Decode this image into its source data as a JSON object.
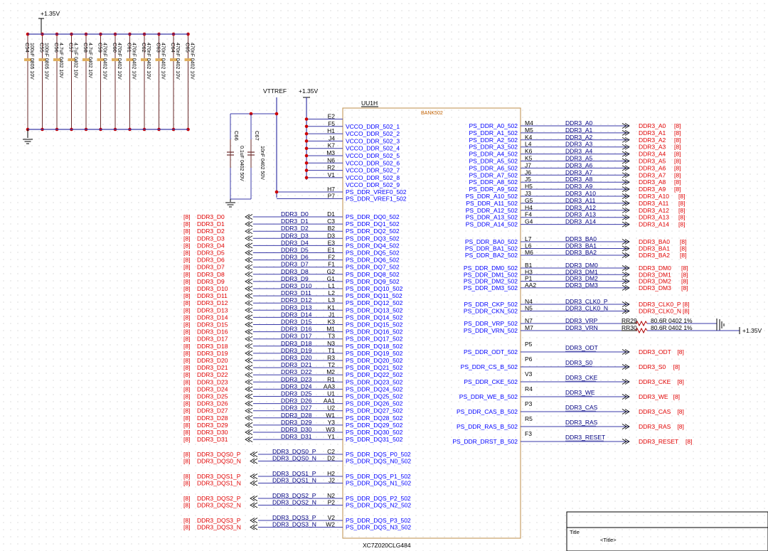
{
  "power": {
    "vcc": "+1.35V",
    "vttref": "VTTREF"
  },
  "decoupling_caps": [
    {
      "ref": "C54",
      "value": "100uF 0805 10V"
    },
    {
      "ref": "C55",
      "value": "100nF 0805 10V"
    },
    {
      "ref": "C56",
      "value": "4.7uF 0402 10V"
    },
    {
      "ref": "C57",
      "value": "4.7uF 0402 10V"
    },
    {
      "ref": "C58",
      "value": "4.7uF 0402 10V"
    },
    {
      "ref": "C59",
      "value": "470nF 0402 10V"
    },
    {
      "ref": "C60",
      "value": "470nF 0402 10V"
    },
    {
      "ref": "C61",
      "value": "470nF 0402 10V"
    },
    {
      "ref": "C62",
      "value": "470nF 0402 10V"
    },
    {
      "ref": "C63",
      "value": "470nF 0402 10V"
    },
    {
      "ref": "C64",
      "value": "470nF 0402 10V"
    },
    {
      "ref": "C65",
      "value": "470nF 0402 10V"
    }
  ],
  "vref_caps": [
    {
      "ref": "C66",
      "value": "0.1uF 0402 50V"
    },
    {
      "ref": "C67",
      "value": "10nF 0402 50V"
    }
  ],
  "ic": {
    "ref": "UU1H",
    "bank": "BANK502",
    "part": "XC7Z020CLG484"
  },
  "vcco_pins": [
    {
      "pin": "E2",
      "name": ""
    },
    {
      "pin": "F5",
      "name": "VCCO_DDR_502_1"
    },
    {
      "pin": "H1",
      "name": "VCCO_DDR_502_2"
    },
    {
      "pin": "J4",
      "name": "VCCO_DDR_502_3"
    },
    {
      "pin": "K7",
      "name": "VCCO_DDR_502_4"
    },
    {
      "pin": "M3",
      "name": "VCCO_DDR_502_5"
    },
    {
      "pin": "N6",
      "name": "VCCO_DDR_502_6"
    },
    {
      "pin": "R2",
      "name": "VCCO_DDR_502_7"
    },
    {
      "pin": "V1",
      "name": "VCCO_DDR_502_8"
    },
    {
      "pin": "",
      "name": "VCCO_DDR_502_9"
    }
  ],
  "vref_pins": [
    {
      "pin": "H7",
      "name": "PS_DDR_VREF0_502"
    },
    {
      "pin": "P7",
      "name": "PS_DDR_VREF1_502"
    }
  ],
  "dq_pins": [
    {
      "pin": "D1",
      "name": "PS_DDR_DQ0_502",
      "net": "DDR3_D0"
    },
    {
      "pin": "C3",
      "name": "PS_DDR_DQ1_502",
      "net": "DDR3_D1"
    },
    {
      "pin": "B2",
      "name": "PS_DDR_DQ2_502",
      "net": "DDR3_D2"
    },
    {
      "pin": "D3",
      "name": "PS_DDR_DQ3_502",
      "net": "DDR3_D3"
    },
    {
      "pin": "E3",
      "name": "PS_DDR_DQ4_502",
      "net": "DDR3_D4"
    },
    {
      "pin": "E1",
      "name": "PS_DDR_DQ5_502",
      "net": "DDR3_D5"
    },
    {
      "pin": "F2",
      "name": "PS_DDR_DQ6_502",
      "net": "DDR3_D6"
    },
    {
      "pin": "F1",
      "name": "PS_DDR_DQ7_502",
      "net": "DDR3_D7"
    },
    {
      "pin": "G2",
      "name": "PS_DDR_DQ8_502",
      "net": "DDR3_D8"
    },
    {
      "pin": "G1",
      "name": "PS_DDR_DQ9_502",
      "net": "DDR3_D9"
    },
    {
      "pin": "L1",
      "name": "PS_DDR_DQ10_502",
      "net": "DDR3_D10"
    },
    {
      "pin": "L2",
      "name": "PS_DDR_DQ11_502",
      "net": "DDR3_D11"
    },
    {
      "pin": "L3",
      "name": "PS_DDR_DQ12_502",
      "net": "DDR3_D12"
    },
    {
      "pin": "K1",
      "name": "PS_DDR_DQ13_502",
      "net": "DDR3_D13"
    },
    {
      "pin": "J1",
      "name": "PS_DDR_DQ14_502",
      "net": "DDR3_D14"
    },
    {
      "pin": "K3",
      "name": "PS_DDR_DQ15_502",
      "net": "DDR3_D15"
    },
    {
      "pin": "M1",
      "name": "PS_DDR_DQ16_502",
      "net": "DDR3_D16"
    },
    {
      "pin": "T3",
      "name": "PS_DDR_DQ17_502",
      "net": "DDR3_D17"
    },
    {
      "pin": "N3",
      "name": "PS_DDR_DQ18_502",
      "net": "DDR3_D18"
    },
    {
      "pin": "T1",
      "name": "PS_DDR_DQ19_502",
      "net": "DDR3_D19"
    },
    {
      "pin": "R3",
      "name": "PS_DDR_DQ20_502",
      "net": "DDR3_D20"
    },
    {
      "pin": "T2",
      "name": "PS_DDR_DQ21_502",
      "net": "DDR3_D21"
    },
    {
      "pin": "M2",
      "name": "PS_DDR_DQ22_502",
      "net": "DDR3_D22"
    },
    {
      "pin": "R1",
      "name": "PS_DDR_DQ23_502",
      "net": "DDR3_D23"
    },
    {
      "pin": "AA3",
      "name": "PS_DDR_DQ24_502",
      "net": "DDR3_D24"
    },
    {
      "pin": "U1",
      "name": "PS_DDR_DQ25_502",
      "net": "DDR3_D25"
    },
    {
      "pin": "AA1",
      "name": "PS_DDR_DQ26_502",
      "net": "DDR3_D26"
    },
    {
      "pin": "U2",
      "name": "PS_DDR_DQ27_502",
      "net": "DDR3_D27"
    },
    {
      "pin": "W1",
      "name": "PS_DDR_DQ28_502",
      "net": "DDR3_D28"
    },
    {
      "pin": "Y3",
      "name": "PS_DDR_DQ29_502",
      "net": "DDR3_D29"
    },
    {
      "pin": "W3",
      "name": "PS_DDR_DQ30_502",
      "net": "DDR3_D30"
    },
    {
      "pin": "Y1",
      "name": "PS_DDR_DQ31_502",
      "net": "DDR3_D31"
    }
  ],
  "dqs_pins": [
    {
      "pin": "C2",
      "name": "PS_DDR_DQS_P0_502",
      "net": "DDR3_DQS0_P"
    },
    {
      "pin": "D2",
      "name": "PS_DDR_DQS_N0_502",
      "net": "DDR3_DQS0_N"
    },
    {
      "pin": "H2",
      "name": "PS_DDR_DQS_P1_502",
      "net": "DDR3_DQS1_P"
    },
    {
      "pin": "J2",
      "name": "PS_DDR_DQS_N1_502",
      "net": "DDR3_DQS1_N"
    },
    {
      "pin": "N2",
      "name": "PS_DDR_DQS_P2_502",
      "net": "DDR3_DQS2_P"
    },
    {
      "pin": "P2",
      "name": "PS_DDR_DQS_N2_502",
      "net": "DDR3_DQS2_N"
    },
    {
      "pin": "V2",
      "name": "PS_DDR_DQS_P3_502",
      "net": "DDR3_DQS3_P"
    },
    {
      "pin": "W2",
      "name": "PS_DDR_DQS_N3_502",
      "net": "DDR3_DQS3_N"
    }
  ],
  "addr_pins": [
    {
      "pin": "M4",
      "name": "PS_DDR_A0_502",
      "net": "DDR3_A0"
    },
    {
      "pin": "M5",
      "name": "PS_DDR_A1_502",
      "net": "DDR3_A1"
    },
    {
      "pin": "K4",
      "name": "PS_DDR_A2_502",
      "net": "DDR3_A2"
    },
    {
      "pin": "L4",
      "name": "PS_DDR_A3_502",
      "net": "DDR3_A3"
    },
    {
      "pin": "K6",
      "name": "PS_DDR_A4_502",
      "net": "DDR3_A4"
    },
    {
      "pin": "K5",
      "name": "PS_DDR_A5_502",
      "net": "DDR3_A5"
    },
    {
      "pin": "J7",
      "name": "PS_DDR_A6_502",
      "net": "DDR3_A6"
    },
    {
      "pin": "J6",
      "name": "PS_DDR_A7_502",
      "net": "DDR3_A7"
    },
    {
      "pin": "J5",
      "name": "PS_DDR_A8_502",
      "net": "DDR3_A8"
    },
    {
      "pin": "H5",
      "name": "PS_DDR_A9_502",
      "net": "DDR3_A9"
    },
    {
      "pin": "J3",
      "name": "PS_DDR_A10_502",
      "net": "DDR3_A10"
    },
    {
      "pin": "G5",
      "name": "PS_DDR_A11_502",
      "net": "DDR3_A11"
    },
    {
      "pin": "H4",
      "name": "PS_DDR_A12_502",
      "net": "DDR3_A12"
    },
    {
      "pin": "F4",
      "name": "PS_DDR_A13_502",
      "net": "DDR3_A13"
    },
    {
      "pin": "G4",
      "name": "PS_DDR_A14_502",
      "net": "DDR3_A14"
    }
  ],
  "ba_pins": [
    {
      "pin": "L7",
      "name": "PS_DDR_BA0_502",
      "net": "DDR3_BA0"
    },
    {
      "pin": "L6",
      "name": "PS_DDR_BA1_502",
      "net": "DDR3_BA1"
    },
    {
      "pin": "M6",
      "name": "PS_DDR_BA2_502",
      "net": "DDR3_BA2"
    }
  ],
  "dm_pins": [
    {
      "pin": "B1",
      "name": "PS_DDR_DM0_502",
      "net": "DDR3_DM0"
    },
    {
      "pin": "H3",
      "name": "PS_DDR_DM1_502",
      "net": "DDR3_DM1"
    },
    {
      "pin": "P1",
      "name": "PS_DDR_DM2_502",
      "net": "DDR3_DM2"
    },
    {
      "pin": "AA2",
      "name": "PS_DDR_DM3_502",
      "net": "DDR3_DM3"
    }
  ],
  "clk_pins": [
    {
      "pin": "N4",
      "name": "PS_DDR_CKP_502",
      "net": "DDR3_CLK0_P"
    },
    {
      "pin": "N5",
      "name": "PS_DDR_CKN_502",
      "net": "DDR3_CLK0_N"
    }
  ],
  "vrp_pins": [
    {
      "pin": "N7",
      "name": "PS_DDR_VRP_502",
      "net": "DDR3_VRP",
      "res": "RR29",
      "res_value": "80.6R 0402 1%"
    },
    {
      "pin": "M7",
      "name": "PS_DDR_VRN_502",
      "net": "DDR3_VRN",
      "res": "RR30",
      "res_value": "80.6R 0402 1%"
    }
  ],
  "ctrl_pins": [
    {
      "pin": "P5",
      "name": "PS_DDR_ODT_502",
      "net": "DDR3_ODT"
    },
    {
      "pin": "P6",
      "name": "PS_DDR_CS_B_502",
      "net": "DDR3_S0"
    },
    {
      "pin": "V3",
      "name": "PS_DDR_CKE_502",
      "net": "DDR3_CKE"
    },
    {
      "pin": "R4",
      "name": "PS_DDR_WE_B_502",
      "net": "DDR3_WE"
    },
    {
      "pin": "P3",
      "name": "PS_DDR_CAS_B_502",
      "net": "DDR3_CAS"
    },
    {
      "pin": "R5",
      "name": "PS_DDR_RAS_B_502",
      "net": "DDR3_RAS"
    },
    {
      "pin": "F3",
      "name": "PS_DDR_DRST_B_502",
      "net": "DDR3_RESET"
    }
  ],
  "page_ref": "[8]",
  "title_block": {
    "label": "Title",
    "value": "<Title>"
  },
  "colors": {
    "wire": "#3a3aa8",
    "net": "#000080",
    "pin": "#0000ff",
    "red": "#e00000",
    "body": "#c8a068",
    "comp": "#6a2a2a",
    "black": "#000000"
  }
}
